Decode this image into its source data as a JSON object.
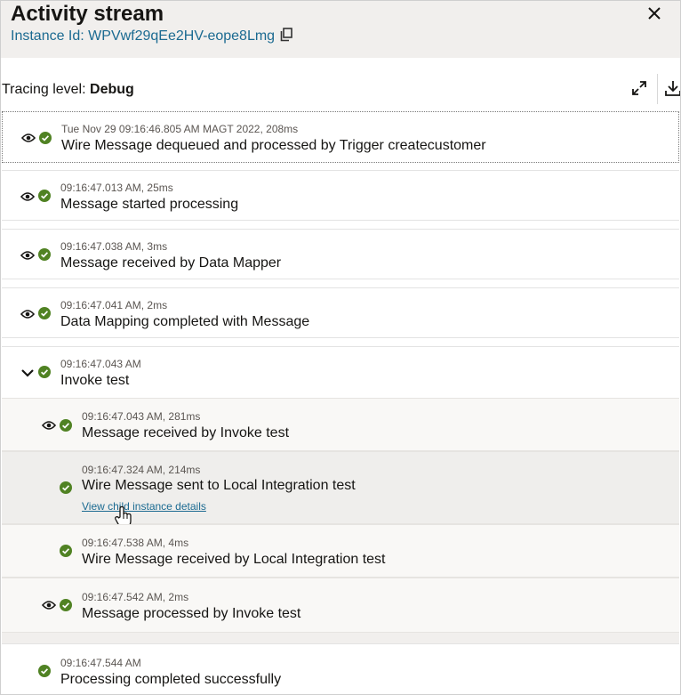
{
  "header": {
    "title": "Activity stream",
    "instance_label": "Instance Id: WPVwf29qEe2HV-eope8Lmg"
  },
  "toolbar": {
    "tracing_label": "Tracing level:",
    "tracing_value": "Debug"
  },
  "icons": {
    "status": "check-circle-icon",
    "view": "eye-icon",
    "close": "close-icon",
    "copy": "copy-icon",
    "expand": "expand-icon",
    "download": "download-icon"
  },
  "colors": {
    "success": "#508223",
    "link": "#1b6a91",
    "header_bg": "#f1efed"
  },
  "entries": [
    {
      "time": "Tue Nov 29 09:16:46.805 AM MAGT 2022, 208ms",
      "message": "Wire Message dequeued and processed by Trigger createcustomer"
    },
    {
      "time": "09:16:47.013 AM, 25ms",
      "message": "Message started processing"
    },
    {
      "time": "09:16:47.038 AM, 3ms",
      "message": "Message received by Data Mapper"
    },
    {
      "time": "09:16:47.041 AM, 2ms",
      "message": "Data Mapping completed with Message"
    },
    {
      "time": "09:16:47.043 AM",
      "message": "Invoke test"
    }
  ],
  "children": [
    {
      "time": "09:16:47.043 AM, 281ms",
      "message": "Message received by Invoke test"
    },
    {
      "time": "09:16:47.324 AM, 214ms",
      "message": "Wire Message sent to Local Integration test",
      "link": "View child instance details"
    },
    {
      "time": "09:16:47.538 AM, 4ms",
      "message": "Wire Message received by Local Integration test"
    },
    {
      "time": "09:16:47.542 AM, 2ms",
      "message": "Message processed by Invoke test"
    }
  ],
  "final_entry": {
    "time": "09:16:47.544 AM",
    "message": "Processing completed successfully"
  }
}
